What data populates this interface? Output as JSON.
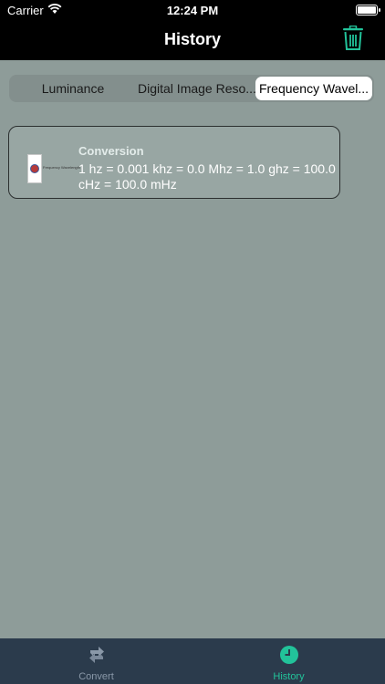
{
  "status_bar": {
    "carrier": "Carrier",
    "time": "12:24 PM"
  },
  "nav": {
    "title": "History",
    "trash_icon": "trash-icon"
  },
  "segments": [
    {
      "label": "Luminance",
      "selected": false
    },
    {
      "label": "Digital Image Reso...",
      "selected": false
    },
    {
      "label": "Frequency Wavel...",
      "selected": true
    }
  ],
  "history": [
    {
      "title": "Conversion",
      "text": "1 hz = 0.001 khz = 0.0 Mhz = 1.0 ghz = 100.0 cHz = 100.0 mHz",
      "thumbnail_caption": "Frequency Wavelength"
    }
  ],
  "tabbar": {
    "convert": {
      "label": "Convert",
      "icon": "convert-icon"
    },
    "history": {
      "label": "History",
      "icon": "clock-icon"
    }
  },
  "colors": {
    "accent": "#22C39A",
    "background": "#8E9C99",
    "tabbar": "#2B3B4C",
    "nav": "#000000"
  }
}
